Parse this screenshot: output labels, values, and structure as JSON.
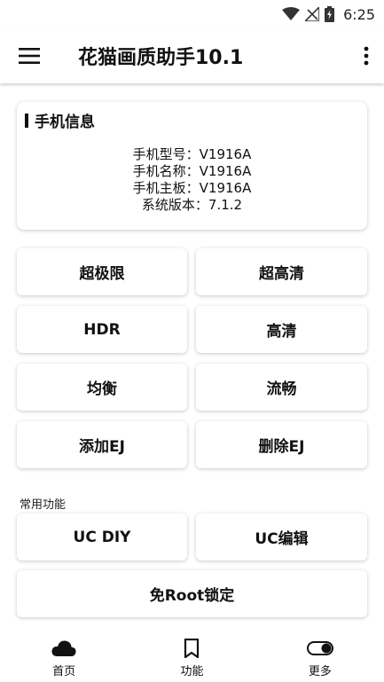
{
  "status_bar": {
    "time": "6:25",
    "icons": [
      "wifi-icon",
      "no-signal-icon",
      "battery-charging-icon"
    ]
  },
  "app_bar": {
    "title": "花猫画质助手10.1",
    "menu_icon": "hamburger-menu-icon",
    "more_icon": "overflow-menu-icon"
  },
  "phone_info": {
    "title": "手机信息",
    "lines": [
      "手机型号：V1916A",
      "手机名称：V1916A",
      "手机主板：V1916A",
      "系统版本：7.1.2"
    ]
  },
  "quality_buttons": [
    {
      "label": "超极限"
    },
    {
      "label": "超高清"
    },
    {
      "label": "HDR"
    },
    {
      "label": "高清"
    },
    {
      "label": "均衡"
    },
    {
      "label": "流畅"
    },
    {
      "label": "添加EJ"
    },
    {
      "label": "删除EJ"
    }
  ],
  "common": {
    "section_label": "常用功能",
    "buttons": [
      {
        "label": "UC DIY"
      },
      {
        "label": "UC编辑"
      },
      {
        "label": "免Root锁定"
      }
    ]
  },
  "bottom_nav": [
    {
      "label": "首页",
      "icon": "cloud-icon"
    },
    {
      "label": "功能",
      "icon": "bookmark-icon"
    },
    {
      "label": "更多",
      "icon": "toggle-icon"
    }
  ]
}
